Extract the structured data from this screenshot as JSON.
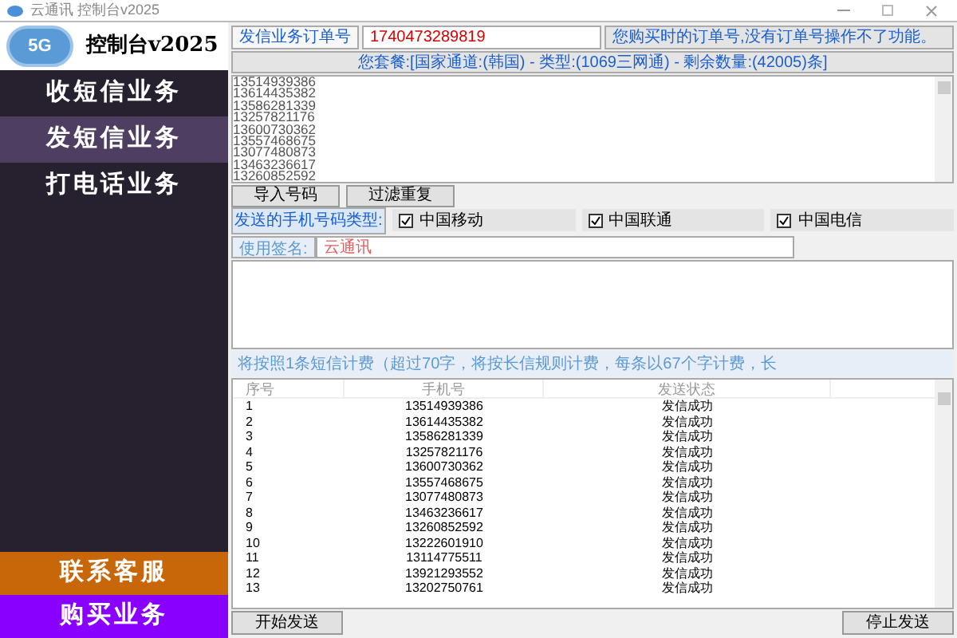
{
  "window": {
    "title": "云通讯 控制台v2025"
  },
  "logo": {
    "badge": "5G",
    "title": "控制台v2025"
  },
  "sidebar": {
    "items": [
      {
        "label": "收短信业务",
        "selected": false
      },
      {
        "label": "发短信业务",
        "selected": true
      },
      {
        "label": "打电话业务",
        "selected": false
      }
    ],
    "bottom_buttons": [
      {
        "label": "联系客服",
        "color": "#c8660a"
      },
      {
        "label": "购买业务",
        "color": "#8a00ff"
      }
    ]
  },
  "order": {
    "label": "发信业务订单号",
    "value": "1740473289819",
    "hint": "您购买时的订单号,没有订单号操作不了功能。"
  },
  "package_info": "您套餐:[国家通道:(韩国) - 类型:(1069三网通) - 剩余数量:(42005)条]",
  "number_list": [
    "13514939386",
    "13614435382",
    "13586281339",
    "13257821176",
    "13600730362",
    "13557468675",
    "13077480873",
    "13463236617",
    "13260852592"
  ],
  "list_buttons": [
    "导入号码",
    "过滤重复"
  ],
  "carrier_types": {
    "label": "发送的手机号码类型:",
    "options": [
      {
        "label": "中国移动",
        "checked": true
      },
      {
        "label": "中国联通",
        "checked": true
      },
      {
        "label": "中国电信",
        "checked": true
      }
    ]
  },
  "signature": {
    "label": "使用签名:",
    "value": "云通讯"
  },
  "note": "将按照1条短信计费（超过70字，将按长信规则计费，每条以67个字计费，长",
  "table": {
    "columns": [
      "序号",
      "手机号",
      "发送状态"
    ],
    "rows": [
      [
        "1",
        "13514939386",
        "发信成功"
      ],
      [
        "2",
        "13614435382",
        "发信成功"
      ],
      [
        "3",
        "13586281339",
        "发信成功"
      ],
      [
        "4",
        "13257821176",
        "发信成功"
      ],
      [
        "5",
        "13600730362",
        "发信成功"
      ],
      [
        "6",
        "13557468675",
        "发信成功"
      ],
      [
        "7",
        "13077480873",
        "发信成功"
      ],
      [
        "8",
        "13463236617",
        "发信成功"
      ],
      [
        "9",
        "13260852592",
        "发信成功"
      ],
      [
        "10",
        "13222601910",
        "发信成功"
      ],
      [
        "11",
        "13114775511",
        "发信成功"
      ],
      [
        "12",
        "13921293552",
        "发信成功"
      ],
      [
        "13",
        "13202750761",
        "发信成功"
      ]
    ]
  },
  "actions": [
    "开始发送",
    "停止发送"
  ]
}
